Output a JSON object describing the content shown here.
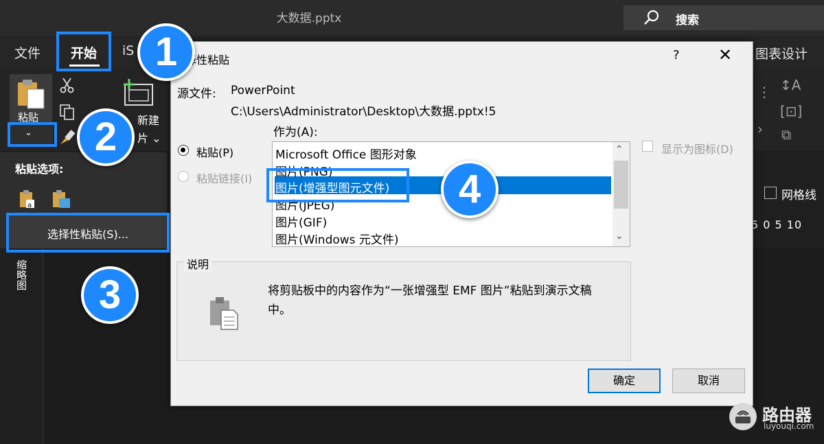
{
  "window": {
    "title": "大数据.pptx",
    "search_label": "搜索"
  },
  "tabs": {
    "file": "文件",
    "home": "开始",
    "is": "iS",
    "chart_design": "图表设计"
  },
  "ribbon": {
    "paste_label": "粘贴",
    "new_slide_label": "新建",
    "new_slide_label2": "片 ⌄",
    "paste_options_label": "粘贴选项:",
    "paste_special_label": "选择性粘贴(S)...",
    "thumbnail_label": "缩略图",
    "gridlines_label": "网格线",
    "ruler_text": "5  0  5 10"
  },
  "dialog": {
    "title": "择性粘贴",
    "help": "?",
    "close": "✕",
    "source_label": "源文件:",
    "source_app": "PowerPoint",
    "source_path": "C:\\Users\\Administrator\\Desktop\\大数据.pptx!5",
    "as_label": "作为(A):",
    "paste_radio": "粘贴(P)",
    "paste_link_radio": "粘贴链接(I)",
    "formats": [
      "Microsoft Office 图形对象",
      "图片(PNG)",
      "图片(增强型图元文件)",
      "图片(JPEG)",
      "图片(GIF)",
      "图片(Windows 元文件)"
    ],
    "selected_index": 2,
    "show_as_icon": "显示为图标(D)",
    "description_legend": "说明",
    "description_text": "将剪贴板中的内容作为“一张增强型 EMF 图片”粘贴到演示文稿中。",
    "ok_label": "确定",
    "cancel_label": "取消"
  },
  "steps": [
    "1",
    "2",
    "3",
    "4"
  ],
  "watermark": {
    "name": "路由器",
    "url": "luyouqi.com"
  },
  "colors": {
    "accent": "#1e88ff",
    "selection": "#0078d7"
  }
}
